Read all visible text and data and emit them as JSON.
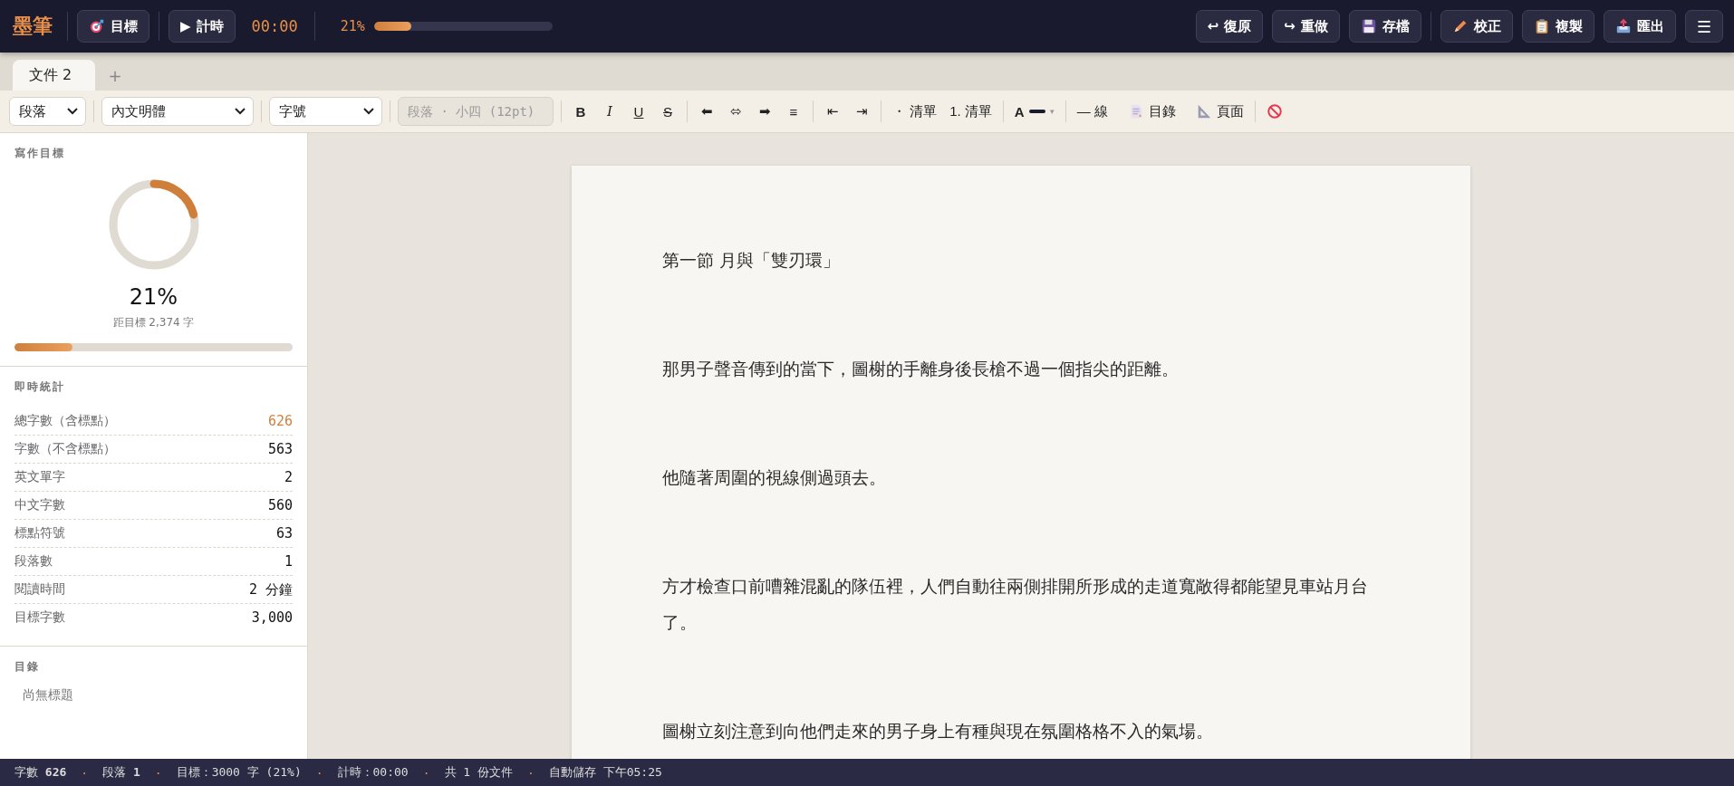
{
  "top_bar": {
    "logo": "墨筆",
    "left_buttons": [
      {
        "kind": "target",
        "label": "目標"
      },
      {
        "kind": "glyph",
        "icon": "▶",
        "label": "計時"
      }
    ],
    "timer": "00:00",
    "progress": {
      "reading": "21%",
      "level": 0.21
    },
    "right_groups": [
      [
        {
          "kind": "glyph",
          "icon": "↩",
          "label": "復原"
        },
        {
          "kind": "glyph",
          "icon": "↪",
          "label": "重做"
        },
        {
          "kind": "floppy",
          "label": "存檔"
        }
      ],
      [
        {
          "kind": "pencil",
          "label": "校正"
        },
        {
          "kind": "clipboard",
          "label": "複製"
        },
        {
          "kind": "outbox",
          "label": "匯出"
        },
        {
          "kind": "glyph",
          "icon": "☰"
        }
      ]
    ]
  },
  "tabs": [
    {
      "label": "文件 2",
      "selected": true
    }
  ],
  "add_tab": "+",
  "toolbar": [
    {
      "kind": "select",
      "value": "段落"
    },
    {
      "kind": "sep"
    },
    {
      "kind": "select",
      "value": "內文明體"
    },
    {
      "kind": "sep"
    },
    {
      "kind": "select",
      "value": "字號"
    },
    {
      "kind": "sep"
    },
    {
      "kind": "readout",
      "placeholder": "段落 · 小四 (12pt)"
    },
    {
      "kind": "sep"
    },
    {
      "kind": "bold",
      "label": "B"
    },
    {
      "kind": "italic",
      "label": "I"
    },
    {
      "kind": "underline",
      "label": "U"
    },
    {
      "kind": "strike",
      "label": "S"
    },
    {
      "kind": "sep"
    },
    {
      "kind": "glyph",
      "label": "⬅"
    },
    {
      "kind": "glyph",
      "label": "⬄"
    },
    {
      "kind": "glyph",
      "label": "➡"
    },
    {
      "kind": "glyph",
      "label": "≡"
    },
    {
      "kind": "sep"
    },
    {
      "kind": "glyph",
      "label": "⇤"
    },
    {
      "kind": "glyph",
      "label": "⇥"
    },
    {
      "kind": "sep"
    },
    {
      "kind": "text",
      "label": "・ 清單"
    },
    {
      "kind": "text",
      "label": "1. 清單"
    },
    {
      "kind": "sep"
    },
    {
      "kind": "color",
      "label": "A",
      "color": "#1a1a2e",
      "caret": "▾"
    },
    {
      "kind": "sep"
    },
    {
      "kind": "text",
      "label": "— 線"
    },
    {
      "kind": "toc",
      "label": "目錄"
    },
    {
      "kind": "ruler",
      "label": "頁面"
    },
    {
      "kind": "sep"
    },
    {
      "kind": "clear"
    }
  ],
  "sidebar": {
    "goal": {
      "heading": "寫作目標",
      "level": 0.21,
      "percent": "21%",
      "remaining": "距目標 2,374 字"
    },
    "stats": {
      "heading": "即時統計",
      "rows": [
        {
          "label": "總字數（含標點）",
          "value": "626",
          "highlight": true
        },
        {
          "label": "字數（不含標點）",
          "value": "563",
          "highlight": false
        },
        {
          "label": "英文單字",
          "value": "2",
          "highlight": false
        },
        {
          "label": "中文字數",
          "value": "560",
          "highlight": false
        },
        {
          "label": "標點符號",
          "value": "63",
          "highlight": false
        },
        {
          "label": "段落數",
          "value": "1",
          "highlight": false
        },
        {
          "label": "閱讀時間",
          "value": "2 分鐘",
          "highlight": false
        },
        {
          "label": "目標字數",
          "value": "3,000",
          "highlight": false
        }
      ]
    },
    "toc": {
      "heading": "目錄",
      "empty": "尚無標題"
    }
  },
  "document": {
    "paragraphs": [
      "第一節 月與「雙刃環」",
      "那男子聲音傳到的當下，圖榭的手離身後長槍不過一個指尖的距離。",
      "他隨著周圍的視線側過頭去。",
      "方才檢查口前嘈雜混亂的隊伍裡，人們自動往兩側排開所形成的走道寬敞得都能望見車站月台了。",
      "圖榭立刻注意到向他們走來的男子身上有種與現在氛圍格格不入的氣場。"
    ]
  },
  "status_bar": [
    {
      "kind": "text",
      "text": "字數 **626**"
    },
    {
      "kind": "dot",
      "text": "·"
    },
    {
      "kind": "text",
      "text": "段落 **1**"
    },
    {
      "kind": "dot",
      "text": "·"
    },
    {
      "kind": "text",
      "text": "目標：3000 字 (21%)"
    },
    {
      "kind": "dot",
      "text": "·"
    },
    {
      "kind": "text",
      "text": "計時：00:00"
    },
    {
      "kind": "dot",
      "text": "·"
    },
    {
      "kind": "text",
      "text": "共 1 份文件"
    },
    {
      "kind": "dot",
      "text": "·"
    },
    {
      "kind": "text",
      "text": "自動儲存 下午05:25"
    }
  ]
}
